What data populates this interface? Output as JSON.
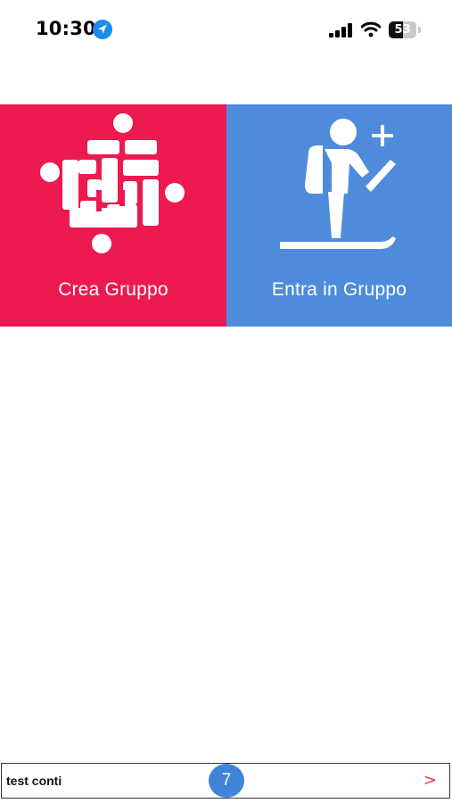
{
  "status_bar": {
    "time": "10:30",
    "battery_level": "53",
    "icons": [
      "location-arrow-icon",
      "cellular-signal-icon",
      "wifi-icon",
      "battery-icon"
    ]
  },
  "tiles": {
    "create": {
      "label": "Crea Gruppo",
      "icon": "puzzle-group-icon",
      "color": "#ec1a4f"
    },
    "join": {
      "label": "Entra in Gruppo",
      "icon": "skier-add-icon",
      "color": "#4e8cdb"
    }
  },
  "bottom_bar": {
    "group_name": "test conti",
    "member_count": "7",
    "arrow": ">",
    "badge_color": "#3f84d9",
    "arrow_color": "#d43a5e"
  }
}
